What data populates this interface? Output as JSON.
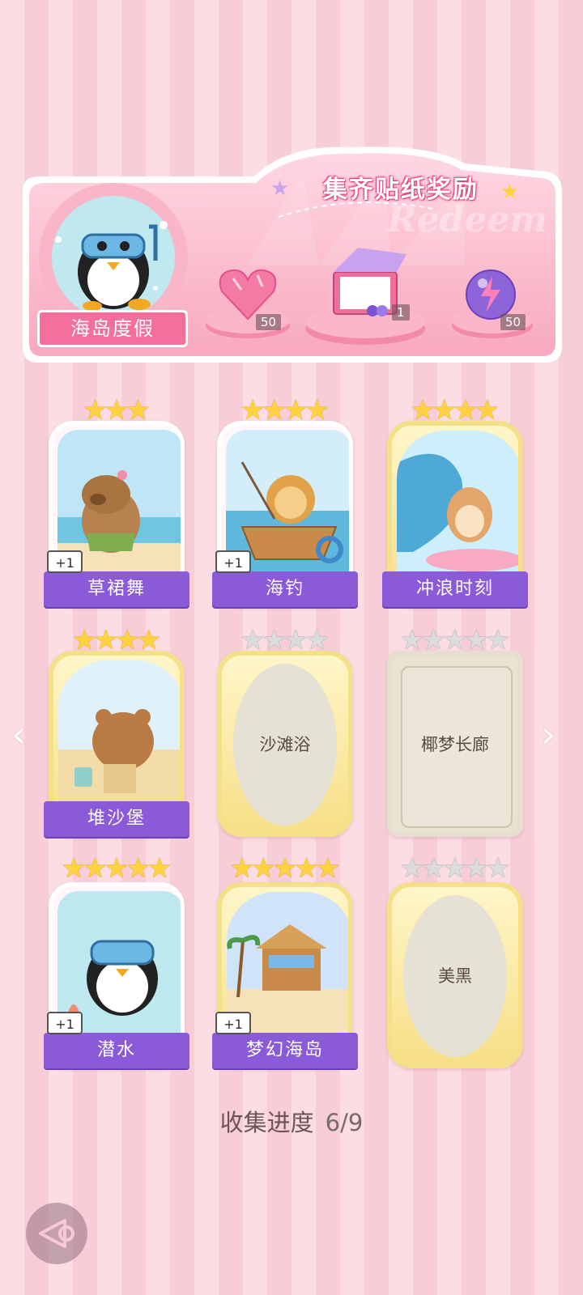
{
  "banner": {
    "title": "集齐贴纸奖励",
    "watermark": "Redeem",
    "badge_label": "海岛度假",
    "rewards": [
      {
        "icon": "pink-heart-gem-icon",
        "count": "50"
      },
      {
        "icon": "gift-box-bundle-icon",
        "count": "1"
      },
      {
        "icon": "purple-lightning-orb-icon",
        "count": "50"
      }
    ]
  },
  "cards": [
    {
      "name": "草裙舞",
      "stars": 3,
      "max_stars": 3,
      "unlocked": true,
      "plus_one": "+1",
      "icon": "capybara-hula-icon"
    },
    {
      "name": "海钓",
      "stars": 4,
      "max_stars": 4,
      "unlocked": true,
      "plus_one": "+1",
      "icon": "lion-fishing-icon"
    },
    {
      "name": "冲浪时刻",
      "stars": 4,
      "max_stars": 4,
      "unlocked": true,
      "plus_one": "",
      "icon": "hamster-surfing-icon"
    },
    {
      "name": "堆沙堡",
      "stars": 4,
      "max_stars": 4,
      "unlocked": true,
      "plus_one": "",
      "icon": "bear-sandcastle-icon"
    },
    {
      "name": "沙滩浴",
      "stars": 0,
      "max_stars": 4,
      "unlocked": false,
      "plus_one": "",
      "icon": ""
    },
    {
      "name": "椰梦长廊",
      "stars": 0,
      "max_stars": 5,
      "unlocked": false,
      "plus_one": "",
      "icon": ""
    },
    {
      "name": "潜水",
      "stars": 5,
      "max_stars": 5,
      "unlocked": true,
      "plus_one": "+1",
      "icon": "penguin-diving-icon"
    },
    {
      "name": "梦幻海岛",
      "stars": 5,
      "max_stars": 5,
      "unlocked": true,
      "plus_one": "+1",
      "icon": "beach-hut-icon"
    },
    {
      "name": "美黑",
      "stars": 0,
      "max_stars": 5,
      "unlocked": false,
      "plus_one": "",
      "icon": ""
    }
  ],
  "progress": {
    "label": "收集进度",
    "value": "6/9"
  },
  "colors": {
    "accent_pink": "#f56f9b",
    "name_bar_purple": "#8a5ad8",
    "star_gold": "#ffd23f"
  }
}
